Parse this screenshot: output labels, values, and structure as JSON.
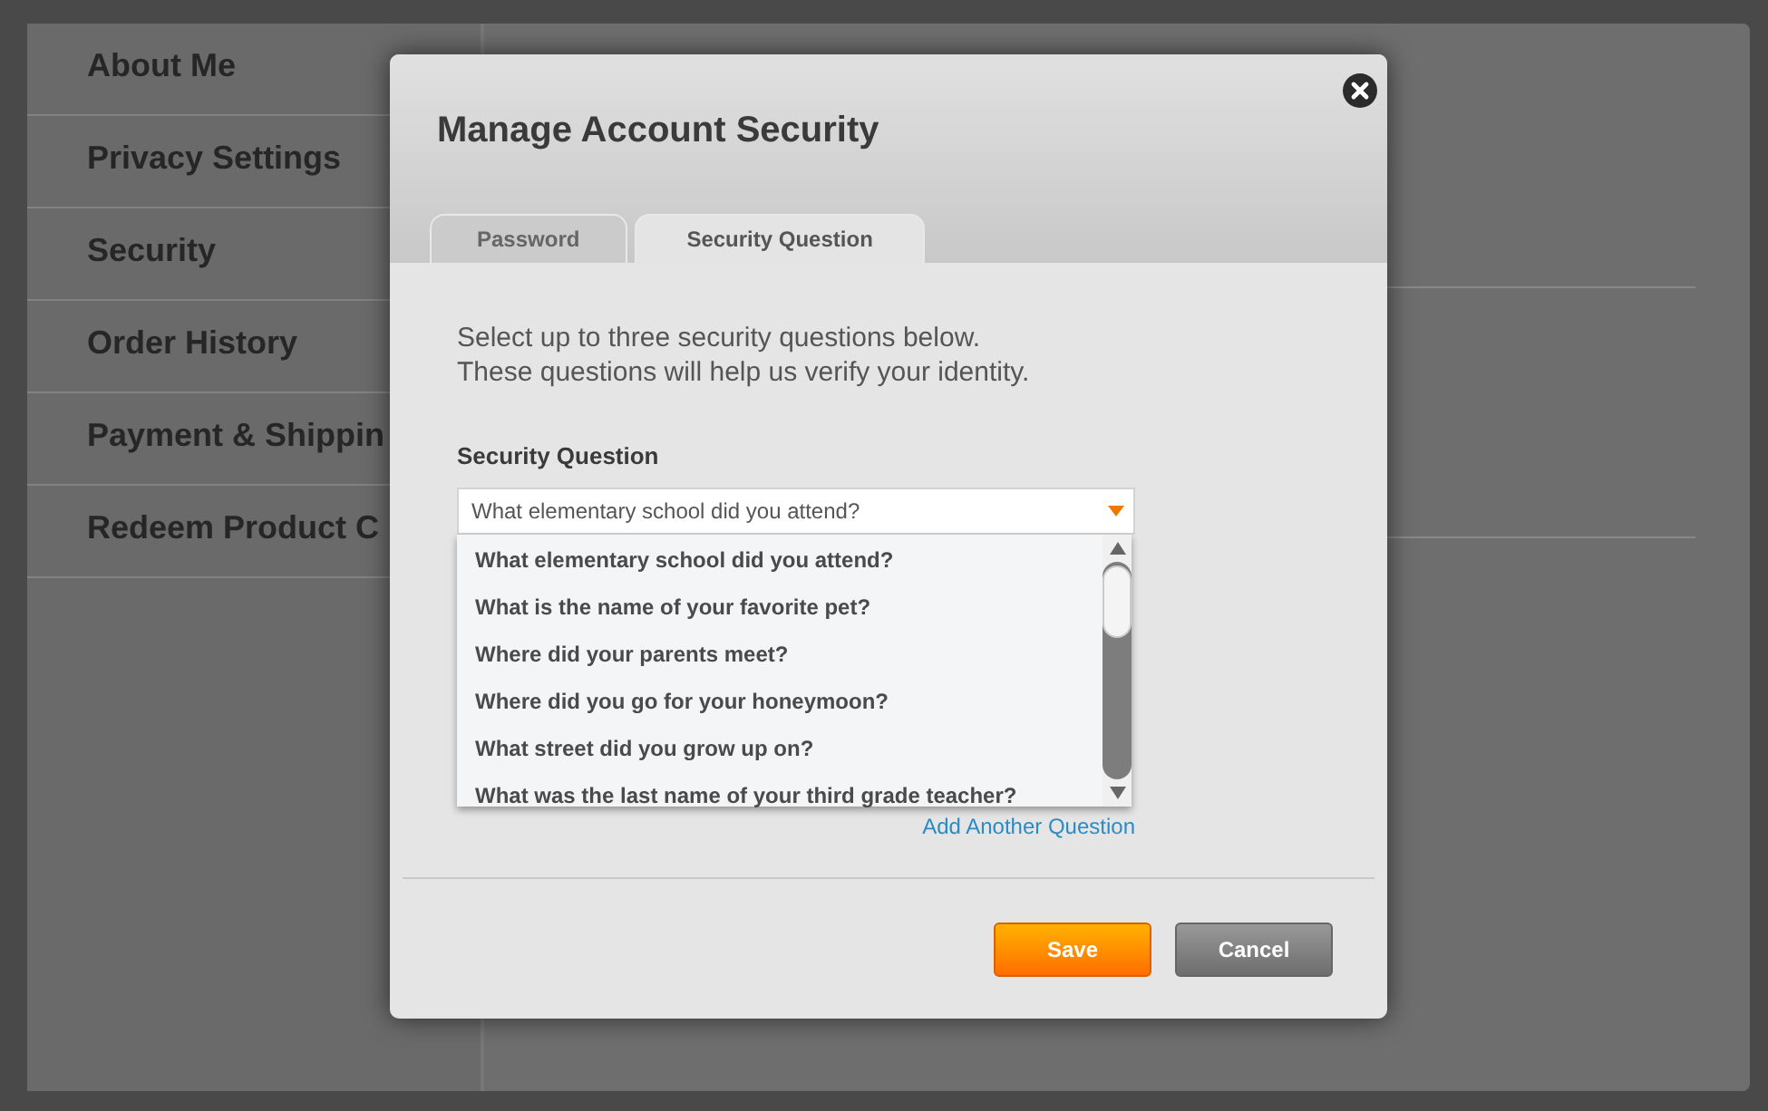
{
  "sidebar": {
    "items": [
      {
        "label": "About Me"
      },
      {
        "label": "Privacy Settings"
      },
      {
        "label": "Security"
      },
      {
        "label": "Order History"
      },
      {
        "label": "Payment & Shippin"
      },
      {
        "label": "Redeem Product C"
      }
    ]
  },
  "dialog": {
    "title": "Manage Account Security",
    "tabs": [
      {
        "label": "Password",
        "selected": false
      },
      {
        "label": "Security Question",
        "selected": true
      }
    ],
    "intro": [
      "Select up to three security questions below.",
      "These questions will help us verify your identity."
    ],
    "field_label": "Security Question",
    "dropdown": {
      "value": "What elementary school did you attend?",
      "expanded": true,
      "options": [
        "What elementary school did you attend?",
        "What is the name of your favorite pet?",
        "Where did your parents meet?",
        "Where did you go for your honeymoon?",
        "What street did you grow up on?",
        "What was the last name of your third grade teacher?"
      ]
    },
    "add_link": "Add Another Question",
    "buttons": [
      {
        "label": "Save",
        "kind": "primary"
      },
      {
        "label": "Cancel",
        "kind": "secondary"
      }
    ]
  }
}
